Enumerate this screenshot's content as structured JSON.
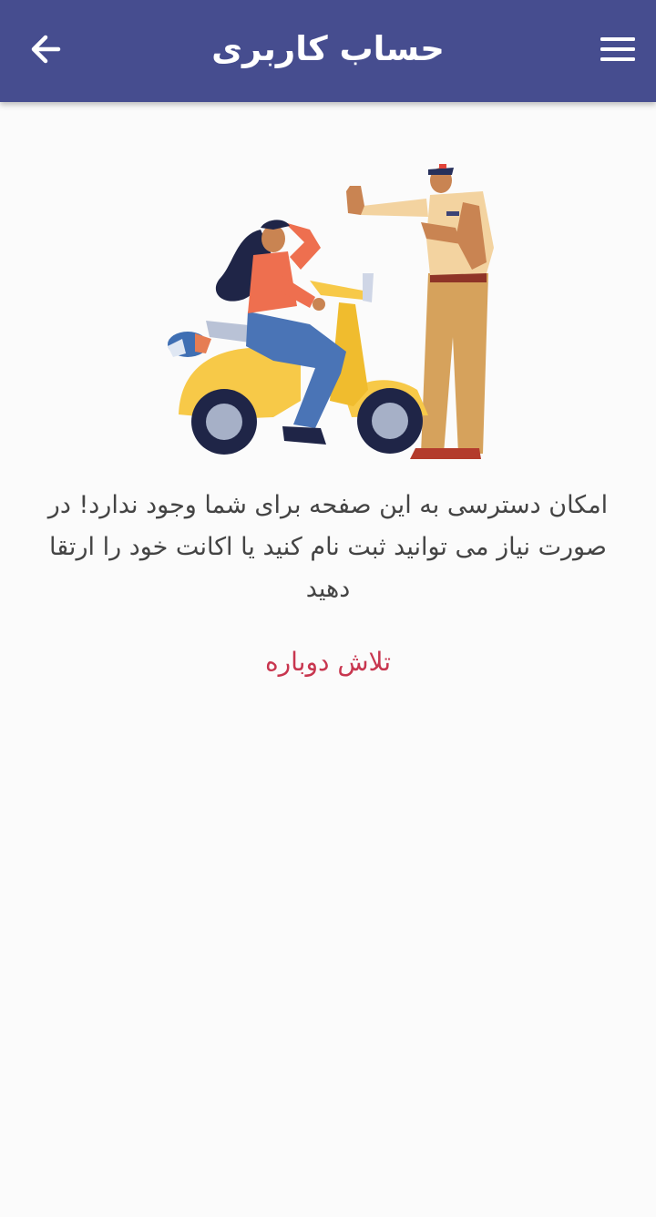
{
  "header": {
    "title": "حساب کاربری",
    "back_icon": "arrow-left-icon",
    "menu_icon": "hamburger-menu-icon",
    "background_color": "#464d8f"
  },
  "illustration": {
    "subject": "access-denied-illustration"
  },
  "message": {
    "text": "امکان دسترسی به این صفحه برای شما وجود ندارد! در صورت نیاز می توانید ثبت نام کنید یا اکانت خود را ارتقا دهید"
  },
  "retry": {
    "label": "تلاش دوباره",
    "color": "#c8364f"
  }
}
